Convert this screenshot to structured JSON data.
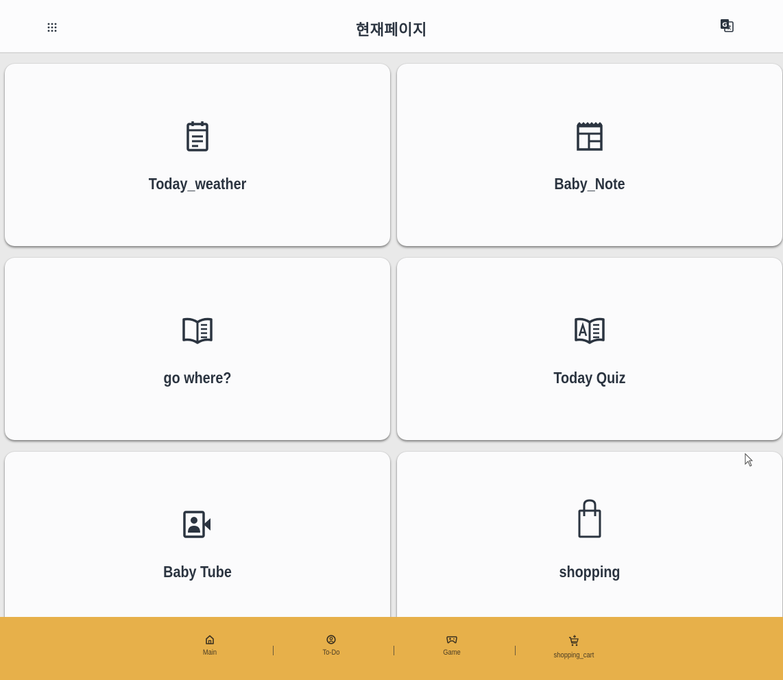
{
  "header": {
    "title": "현재페이지",
    "menu_icon": "apps-grid-icon",
    "translate_icon": "google-translate-icon"
  },
  "cards": [
    {
      "label": "Today_weather",
      "icon": "note-calendar-icon"
    },
    {
      "label": "Baby_Note",
      "icon": "table-layout-icon"
    },
    {
      "label": "go where?",
      "icon": "open-book-icon"
    },
    {
      "label": "Today Quiz",
      "icon": "quiz-book-icon"
    },
    {
      "label": "Baby Tube",
      "icon": "video-contact-icon"
    },
    {
      "label": "shopping",
      "icon": "shopping-bag-icon"
    }
  ],
  "bottom_nav": {
    "items": [
      {
        "label": "Main",
        "icon": "home-icon"
      },
      {
        "label": "To-Do",
        "icon": "face-circle-icon"
      },
      {
        "label": "Game",
        "icon": "gamepad-icon"
      },
      {
        "label": "shopping_cart",
        "icon": "add-cart-icon"
      }
    ]
  },
  "colors": {
    "accent": "#e7b04a",
    "card_bg": "#fbfbfc",
    "page_bg": "#e9e9e9",
    "text": "#2b3440"
  }
}
